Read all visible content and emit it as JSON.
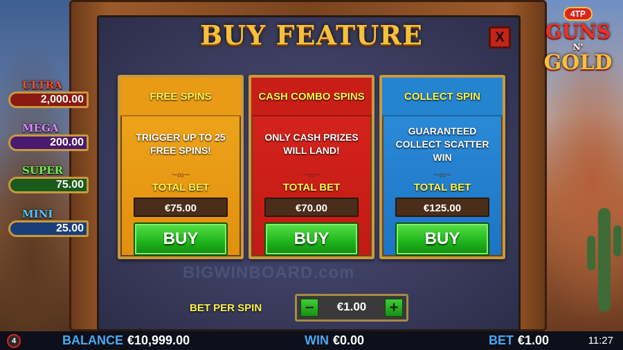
{
  "title": "BUY FEATURE",
  "close_label": "X",
  "cards": [
    {
      "name": "FREE SPINS",
      "description": "TRIGGER UP TO 25 FREE SPINS!",
      "flourish": "~∞~",
      "total_bet_label": "TOTAL BET",
      "price": "€75.00",
      "buy_label": "BUY",
      "color": "#f0a81c"
    },
    {
      "name": "CASH COMBO SPINS",
      "description": "ONLY CASH PRIZES WILL LAND!",
      "flourish": "~∞~",
      "total_bet_label": "TOTAL BET",
      "price": "€70.00",
      "buy_label": "BUY",
      "color": "#d8251e"
    },
    {
      "name": "COLLECT SPIN",
      "description": "GUARANTEED COLLECT SCATTER WIN",
      "flourish": "~∞~",
      "total_bet_label": "TOTAL BET",
      "price": "€125.00",
      "buy_label": "BUY",
      "color": "#2f8fdc"
    }
  ],
  "watermark": "BIGWINBOARD.com",
  "bet_per_spin": {
    "label": "BET PER SPIN",
    "value": "€1.00",
    "minus": "−",
    "plus": "+"
  },
  "jackpots": [
    {
      "label": "ULTRA",
      "value": "2,000.00"
    },
    {
      "label": "MEGA",
      "value": "200.00"
    },
    {
      "label": "SUPER",
      "value": "75.00"
    },
    {
      "label": "MINI",
      "value": "25.00"
    }
  ],
  "logo": {
    "badge": "4TP",
    "line1": "GUNS",
    "line2": "N'",
    "line3": "GOLD"
  },
  "bottom_bar": {
    "provider_logo": "4",
    "balance_label": "BALANCE",
    "balance_value": "€10,999.00",
    "win_label": "WIN",
    "win_value": "€0.00",
    "bet_label": "BET",
    "bet_value": "€1.00",
    "time": "11:27"
  },
  "colors": {
    "title_gold": "#f5c13c",
    "label_yellow": "#fff34a",
    "buy_green": "#22b81e",
    "close_red": "#c2231a",
    "bottom_label_blue": "#4aa8f0"
  }
}
